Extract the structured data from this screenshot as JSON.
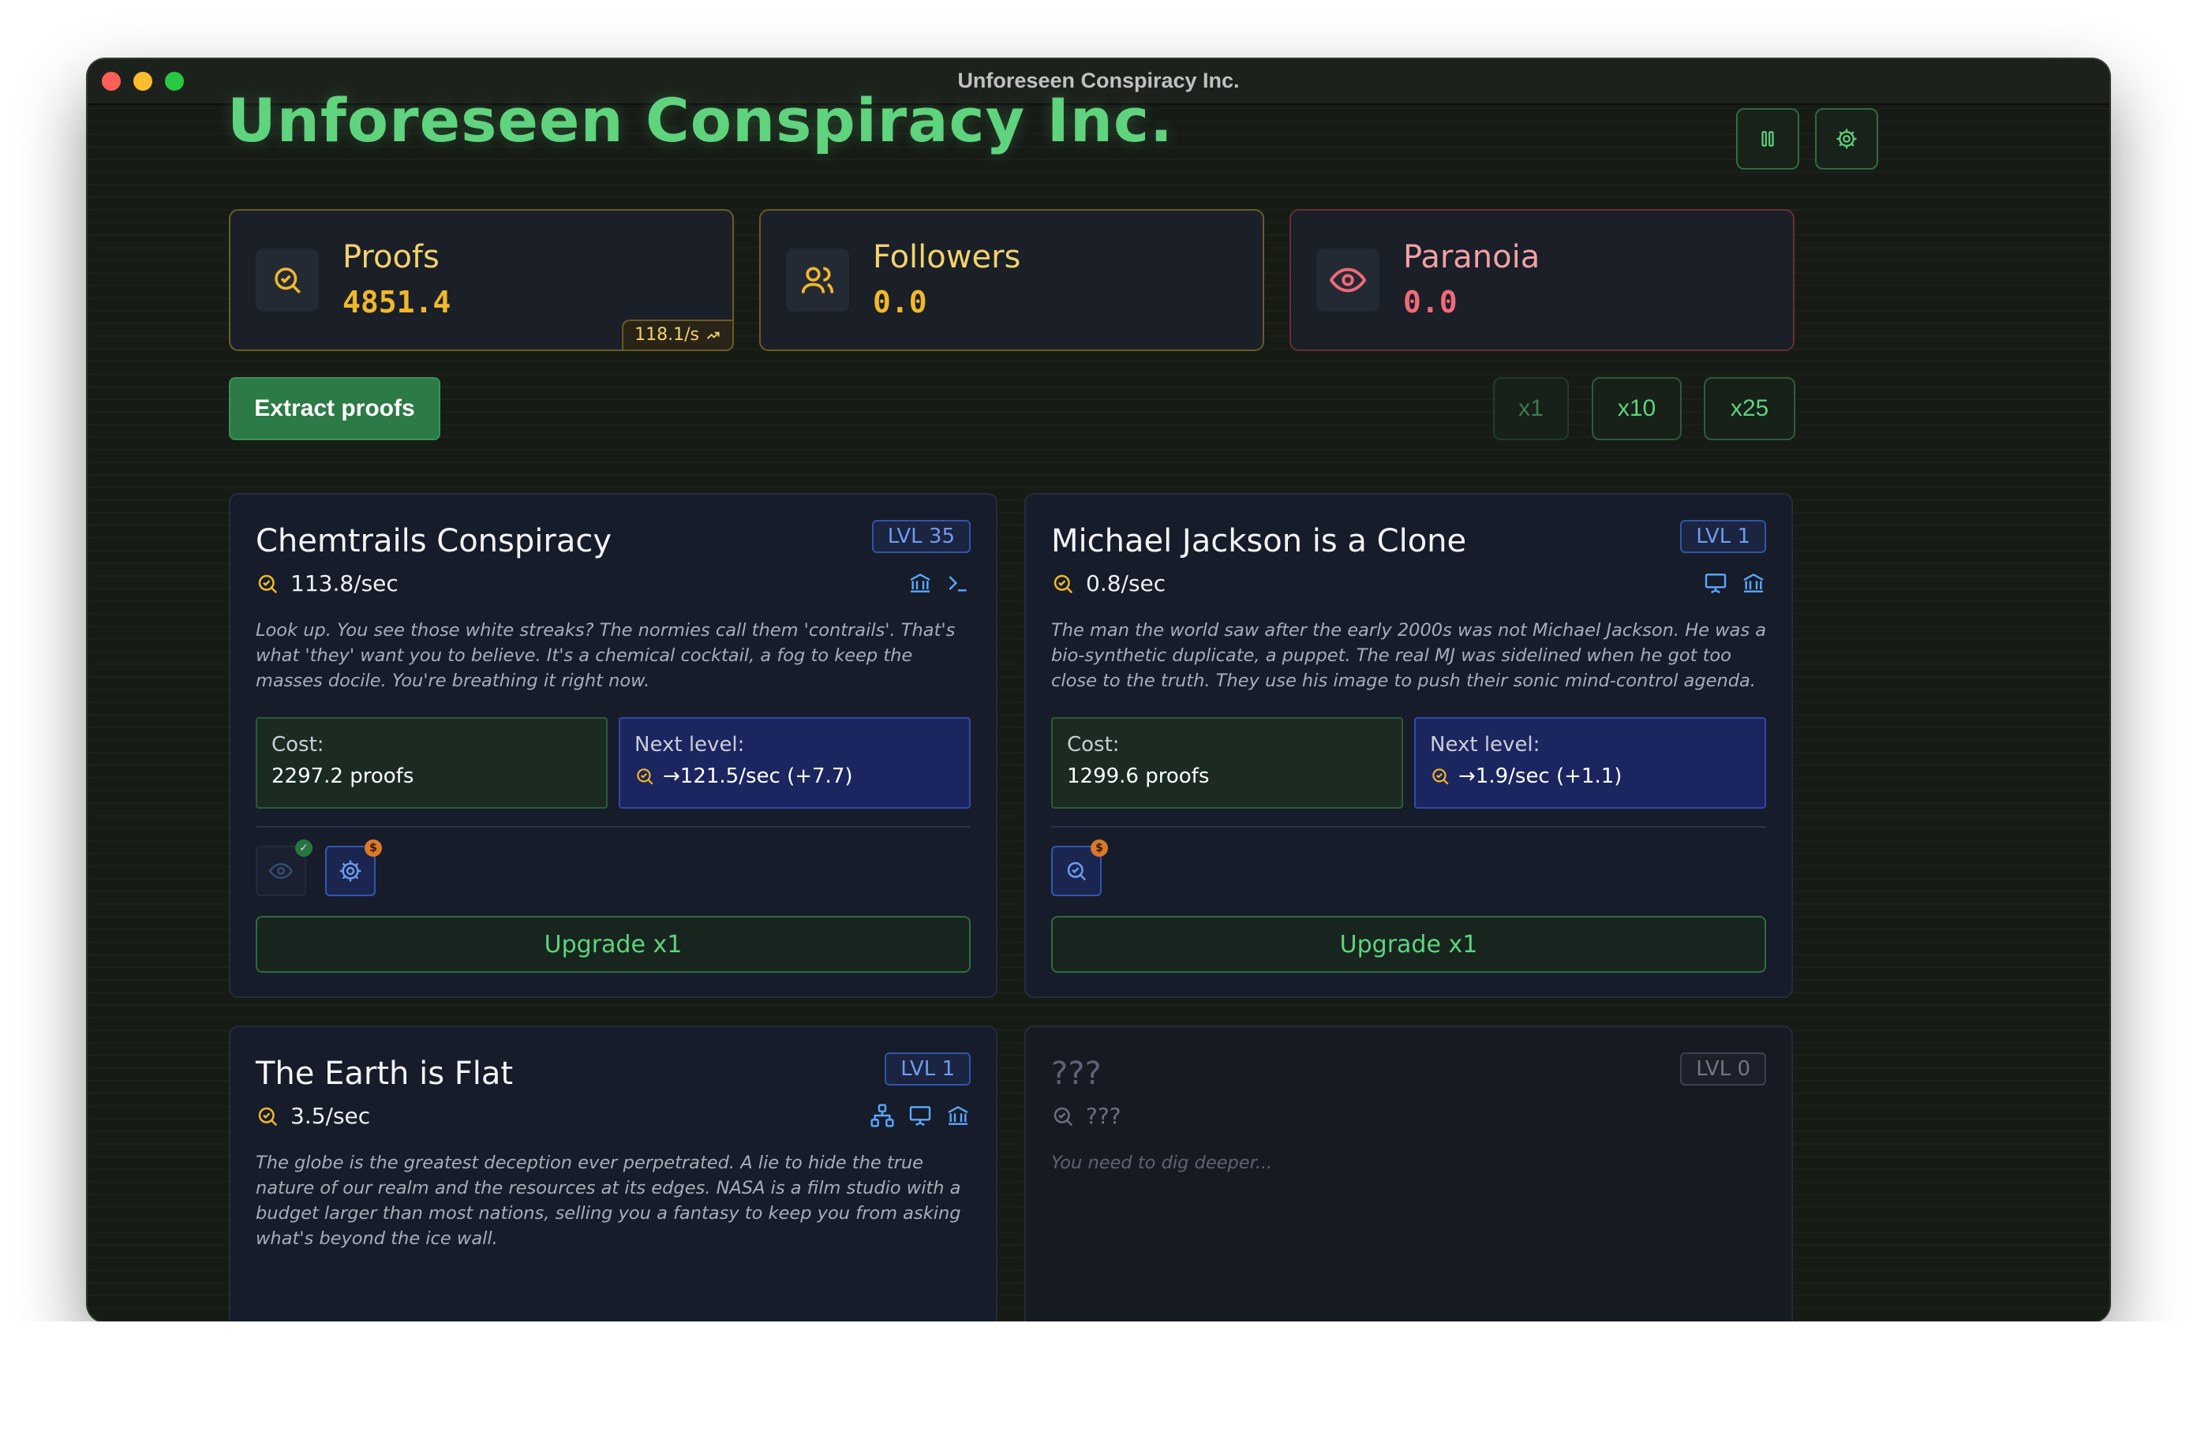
{
  "window": {
    "title": "Unforeseen Conspiracy Inc."
  },
  "header": {
    "title": "Unforeseen Conspiracy Inc.",
    "buttons": [
      {
        "name": "pause",
        "icon": "pause-icon"
      },
      {
        "name": "settings",
        "icon": "gear-icon"
      }
    ]
  },
  "stats": {
    "proofs": {
      "label": "Proofs",
      "value": "4851.4",
      "rate": "118.1/s",
      "icon": "search-check-icon",
      "color": "#f0b82a"
    },
    "followers": {
      "label": "Followers",
      "value": "0.0",
      "icon": "users-icon",
      "color": "#f0b82a"
    },
    "paranoia": {
      "label": "Paranoia",
      "value": "0.0",
      "icon": "eye-icon",
      "color": "#f06a78"
    }
  },
  "actions": {
    "extract_label": "Extract proofs",
    "multipliers": [
      "x1",
      "x10",
      "x25"
    ],
    "selected_multiplier": "x1"
  },
  "conspiracies": [
    {
      "title": "Chemtrails Conspiracy",
      "level": "LVL 35",
      "rate": "113.8/sec",
      "tags": [
        "bank-icon",
        "terminal-icon"
      ],
      "description": "Look up. You see those white streaks? The normies call them 'contrails'. That's what 'they' want you to believe. It's a chemical cocktail, a fog to keep the masses docile. You're breathing it right now.",
      "cost_label": "Cost:",
      "cost_value": "2297.2 proofs",
      "next_label": "Next level:",
      "next_value": "→121.5/sec (+7.7)",
      "upgrades": [
        {
          "icon": "eye-icon",
          "state": "owned"
        },
        {
          "icon": "gear-icon",
          "state": "available"
        }
      ],
      "upgrade_label": "Upgrade x1"
    },
    {
      "title": "Michael Jackson is a Clone",
      "level": "LVL 1",
      "rate": "0.8/sec",
      "tags": [
        "presentation-icon",
        "bank-icon"
      ],
      "description": "The man the world saw after the early 2000s was not Michael Jackson. He was a bio-synthetic duplicate, a puppet. The real MJ was sidelined when he got too close to the truth. They use his image to push their sonic mind-control agenda.",
      "cost_label": "Cost:",
      "cost_value": "1299.6 proofs",
      "next_label": "Next level:",
      "next_value": "→1.9/sec (+1.1)",
      "upgrades": [
        {
          "icon": "search-check-icon",
          "state": "available"
        }
      ],
      "upgrade_label": "Upgrade x1"
    },
    {
      "title": "The Earth is Flat",
      "level": "LVL 1",
      "rate": "3.5/sec",
      "tags": [
        "network-icon",
        "presentation-icon",
        "bank-icon"
      ],
      "description": "The globe is the greatest deception ever perpetrated. A lie to hide the true nature of our realm and the resources at its edges. NASA is a film studio with a budget larger than most nations, selling you a fantasy to keep you from asking what's beyond the ice wall."
    },
    {
      "title": "???",
      "level": "LVL 0",
      "rate": "???",
      "description": "You need to dig deeper..."
    }
  ]
}
